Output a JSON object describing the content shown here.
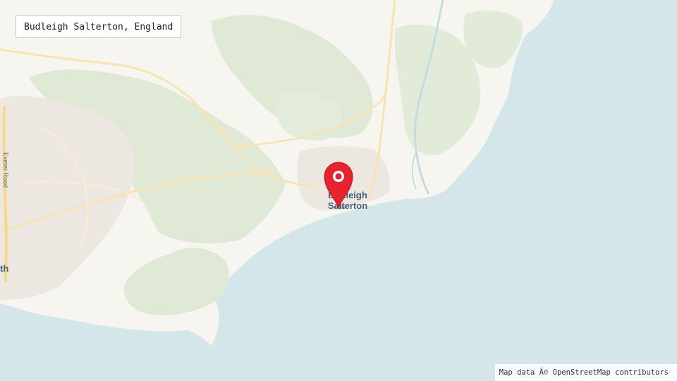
{
  "search": {
    "value": "Budleigh Salterton, England"
  },
  "map": {
    "place_label_line1": "Budleigh",
    "place_label_line2": "Salterton",
    "city_fragment_label": "th",
    "road_label": "Exeter Road",
    "marker_icon": "map-pin-icon",
    "colors": {
      "sea": "#d5e6ea",
      "land": "#f7f5f0",
      "green": "#dfe9d5",
      "urban": "#ece8e1",
      "road": "#f9e3b3",
      "marker": "#e5242f"
    }
  },
  "attribution": {
    "text": "Map data Â© OpenStreetMap contributors"
  }
}
